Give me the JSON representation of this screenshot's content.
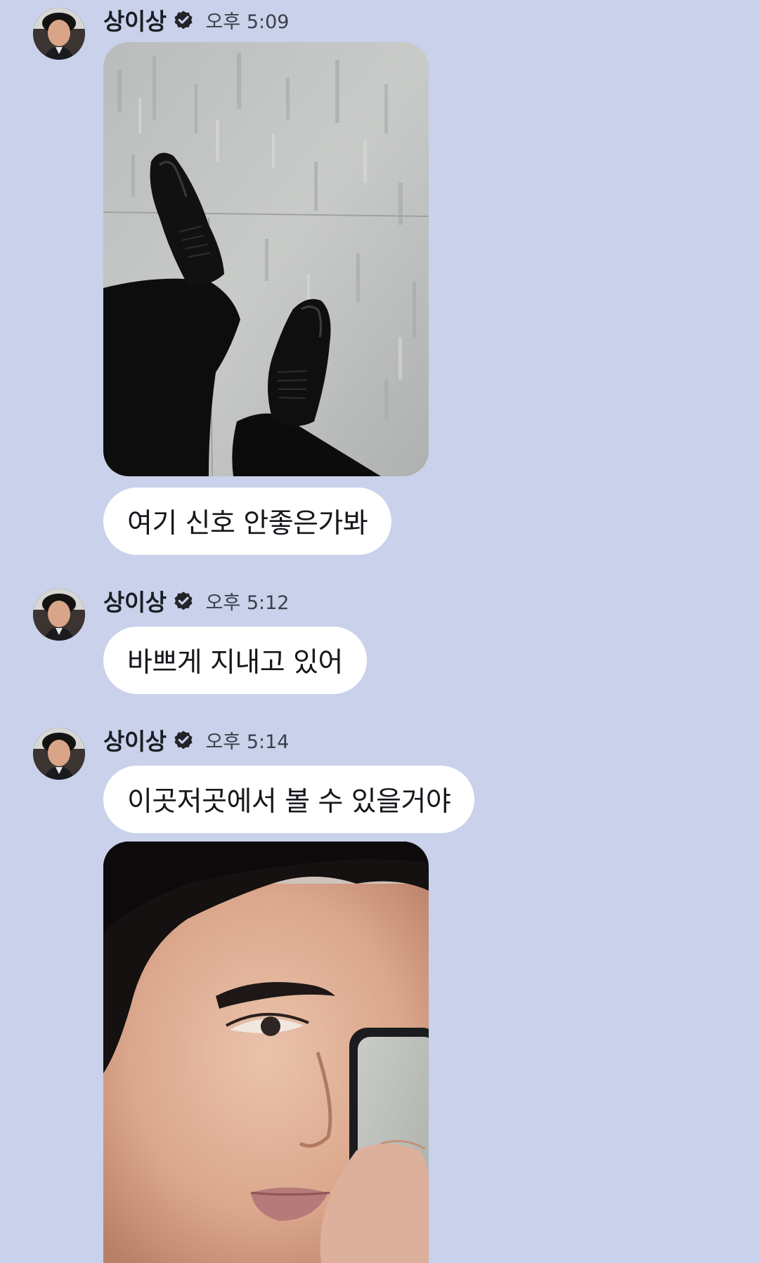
{
  "thread": {
    "messages": [
      {
        "sender": "상이상",
        "time": "오후 5:09",
        "photo": "photo-black-dress-shoes",
        "text": "여기 신호 안좋은가봐"
      },
      {
        "sender": "상이상",
        "time": "오후 5:12",
        "text": "바쁘게 지내고 있어"
      },
      {
        "sender": "상이상",
        "time": "오후 5:14",
        "text": "이곳저곳에서 볼 수 있을거야",
        "photo": "photo-mirror-selfie"
      }
    ]
  },
  "colors": {
    "background": "#c9d1eb",
    "bubble": "#ffffff",
    "verified_badge": "#222428"
  },
  "icons": {
    "verified": "verified-check-icon"
  }
}
